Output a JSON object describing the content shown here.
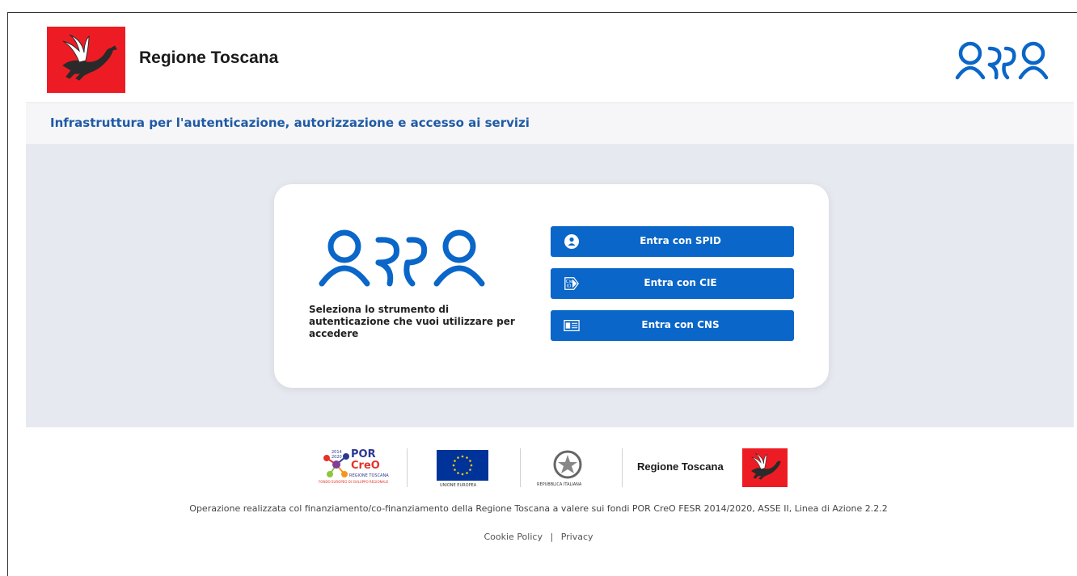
{
  "header": {
    "brand_title": "Regione Toscana",
    "brand_logo_icon": "pegasus-icon",
    "arpa_logo_icon": "arpa-logo-icon",
    "brand_color": "#ed1c24"
  },
  "subheader": {
    "title": "Infrastruttura per l'autenticazione, autorizzazione e accesso ai servizi",
    "color": "#1f5aa6"
  },
  "login_card": {
    "logo_icon": "arpa-logo-icon",
    "instruction": "Seleziona lo strumento di autenticazione che vuoi utilizzare per accedere",
    "buttons": [
      {
        "label": "Entra con SPID",
        "icon": "spid-icon"
      },
      {
        "label": "Entra con CIE",
        "icon": "cie-id-icon"
      },
      {
        "label": "Entra con CNS",
        "icon": "smart-card-icon"
      }
    ],
    "button_color": "#0a66c8"
  },
  "footer": {
    "logos": {
      "por": {
        "line1": "POR",
        "line2": "CreO",
        "years_top": "2014",
        "years_bottom": "2020",
        "caption1": "REGIONE TOSCANA",
        "caption2": "FONDO EUROPEO DI SVILUPPO REGIONALE"
      },
      "eu": {
        "caption": "UNIONE EUROPEA"
      },
      "italy": {
        "caption": "REPUBBLICA ITALIANA"
      },
      "rt": {
        "title": "Regione Toscana"
      }
    },
    "note": "Operazione realizzata col finanziamento/co-finanziamento della Regione Toscana a valere sui fondi POR CreO FESR 2014/2020, ASSE II, Linea di Azione 2.2.2",
    "links": [
      {
        "label": "Cookie Policy"
      },
      {
        "label": "Privacy"
      }
    ],
    "separator": "|"
  }
}
